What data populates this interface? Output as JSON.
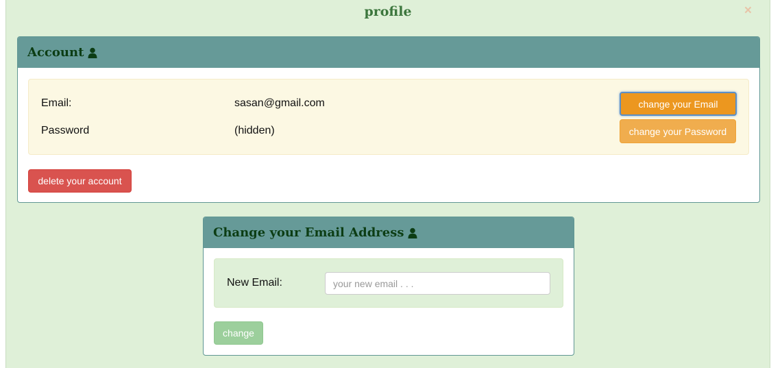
{
  "modal": {
    "title": "profile",
    "close_label": "×"
  },
  "account": {
    "heading": "Account",
    "email_label": "Email:",
    "email_value": "sasan@gmail.com",
    "password_label": "Password",
    "password_value": "(hidden)",
    "change_email_button": "change your Email",
    "change_password_button": "change your Password",
    "delete_button": "delete your account"
  },
  "change_email": {
    "heading": "Change your Email Address",
    "new_email_label": "New Email:",
    "new_email_placeholder": "your new email . . .",
    "new_email_value": "",
    "submit_button": "change"
  },
  "colors": {
    "modal_background": "#dff0d8",
    "panel_heading": "#669a98",
    "title_green": "#3c763d",
    "heading_text": "#0c3d14",
    "warning_button": "#ec971f",
    "danger_button": "#d9534f",
    "success_button_disabled": "#9ccf9c"
  },
  "icons": {
    "heading_icon": "user-icon",
    "close_icon": "close-icon"
  }
}
